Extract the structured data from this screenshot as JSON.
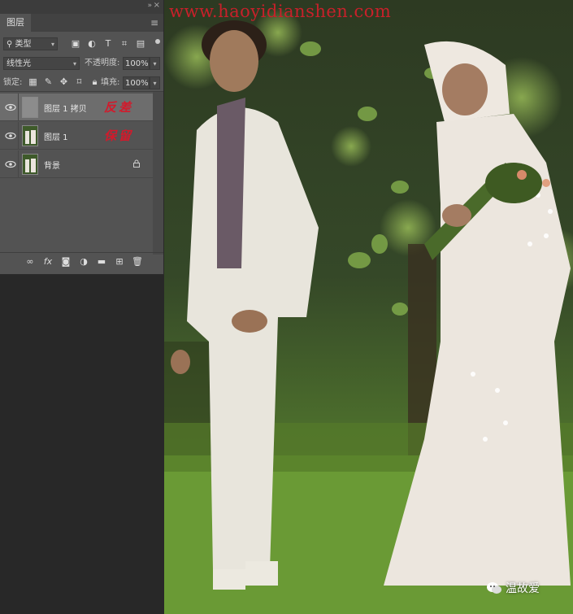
{
  "watermark": "www.haoyidianshen.com",
  "wechat_label": "温故爱",
  "panel": {
    "tab": "图层",
    "filter": "类型",
    "blend_mode": "线性光",
    "opacity_label": "不透明度:",
    "opacity_value": "100%",
    "lock_label": "锁定:",
    "fill_label": "填充:",
    "fill_value": "100%",
    "layers": [
      {
        "name": "图层 1 拷贝",
        "note": "反差",
        "selected": true
      },
      {
        "name": "图层 1",
        "note": "保留",
        "selected": false
      },
      {
        "name": "背景",
        "note": "",
        "selected": false
      }
    ],
    "filter_icons": [
      "image-filter-icon",
      "adjustment-filter-icon",
      "type-filter-icon",
      "shape-filter-icon",
      "smart-object-filter-icon"
    ],
    "lock_icons": [
      "lock-transparent-icon",
      "lock-paint-icon",
      "lock-position-icon",
      "lock-artboard-icon",
      "lock-all-icon"
    ],
    "bottom_icons": [
      "link-layers-icon",
      "fx-icon",
      "layer-mask-icon",
      "adjustment-layer-icon",
      "folder-icon",
      "new-layer-icon",
      "trash-icon"
    ]
  }
}
